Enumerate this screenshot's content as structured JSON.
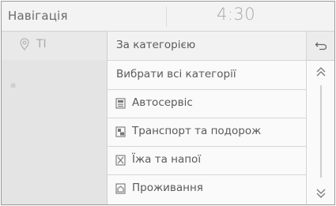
{
  "header": {
    "title": "Навігація",
    "clock": "4:30"
  },
  "left_panel": {
    "label": "TI",
    "icon": "map-pin-icon"
  },
  "list": {
    "header_label": "За категорією",
    "items": [
      {
        "label": "Вибрати всі категорії",
        "icon": null
      },
      {
        "label": "Автосервіс",
        "icon": "car-service-icon"
      },
      {
        "label": "Транспорт та подорож",
        "icon": "transport-icon"
      },
      {
        "label": "Їжа та напої",
        "icon": "food-icon"
      },
      {
        "label": "Проживання",
        "icon": "lodging-icon"
      }
    ]
  },
  "controls": {
    "back": "back-arrow-icon",
    "scroll_up": "double-chevron-up-icon",
    "scroll_down": "double-chevron-down-icon"
  }
}
